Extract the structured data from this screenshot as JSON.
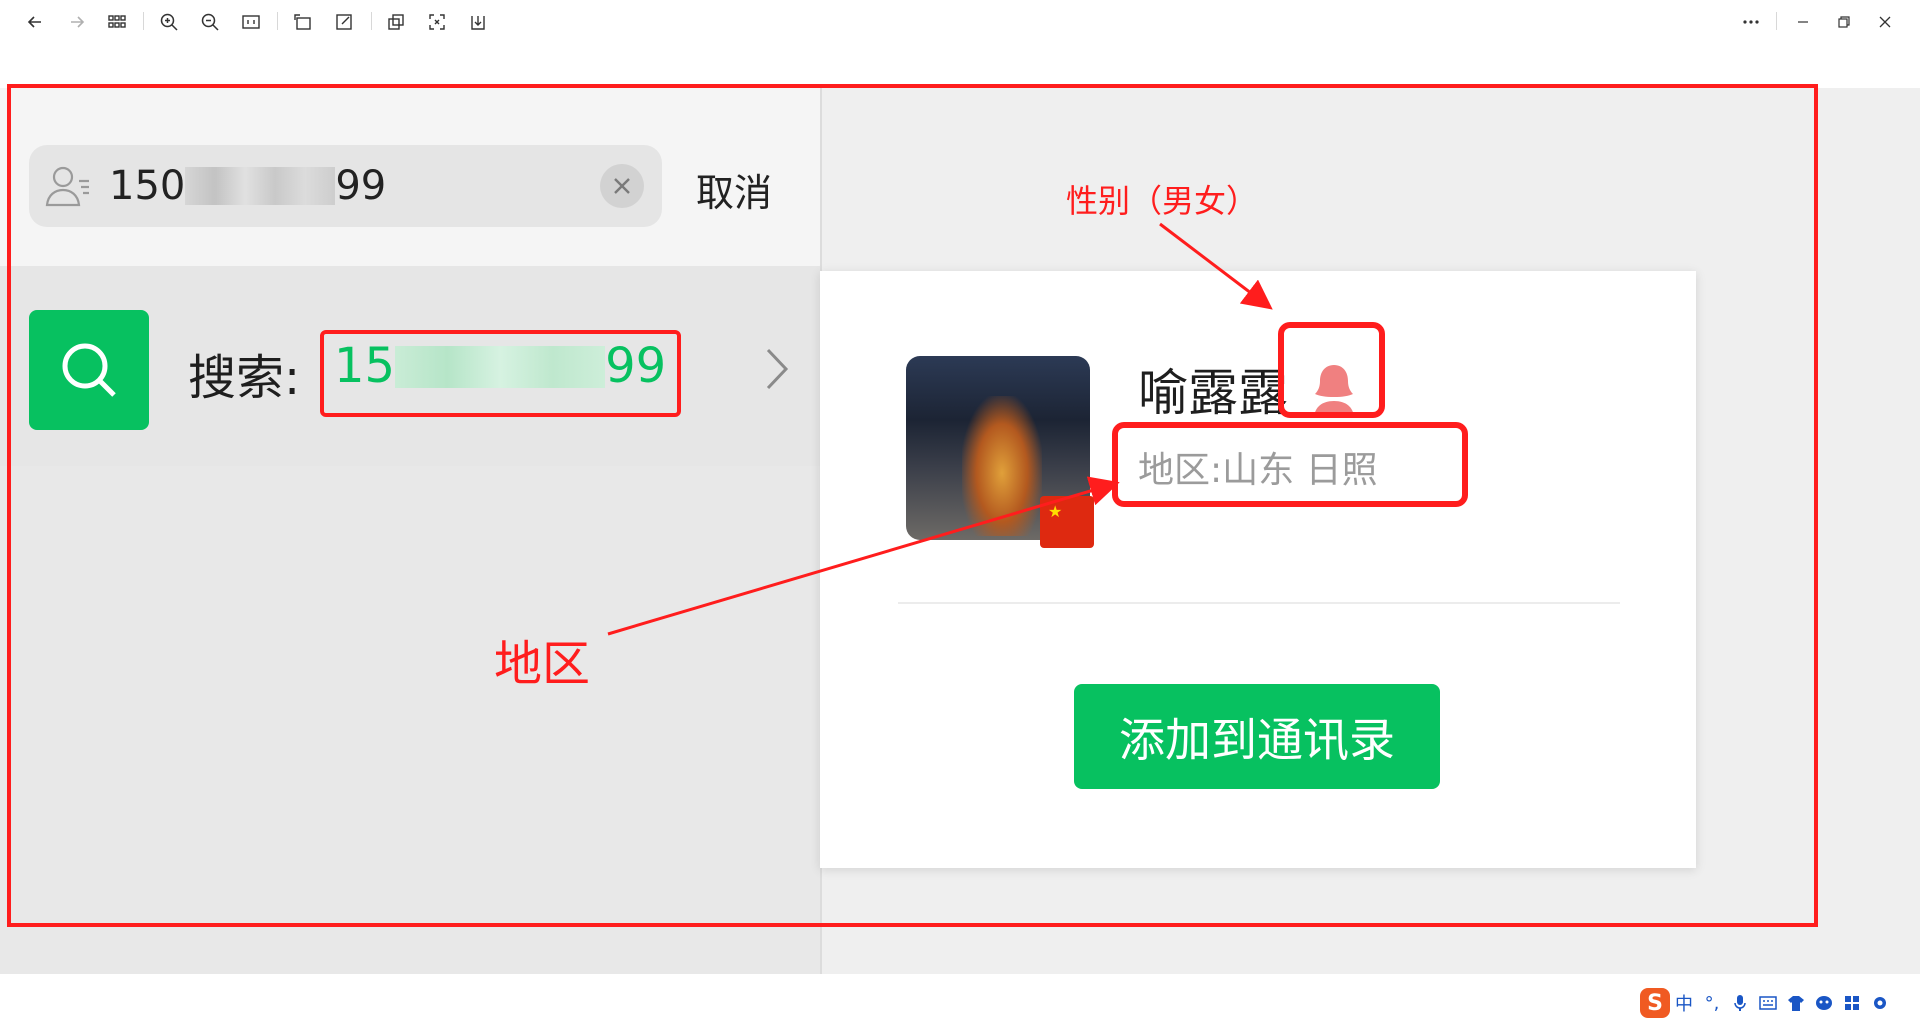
{
  "toolbar": {
    "icons": [
      "back-icon",
      "forward-icon",
      "grid-icon",
      "zoom-in-icon",
      "zoom-out-icon",
      "actual-size-icon",
      "rotate-icon",
      "edit-icon",
      "compare-icon",
      "fit-icon",
      "download-icon",
      "more-icon",
      "minimize-icon",
      "restore-icon",
      "close-icon"
    ]
  },
  "search": {
    "prefix": "150",
    "suffix": "99",
    "cancel_label": "取消"
  },
  "result": {
    "label": "搜索:",
    "num_prefix": "15",
    "num_suffix": "99"
  },
  "profile": {
    "nickname": "喻露露",
    "region": "地区:山东 日照",
    "add_button": "添加到通讯录",
    "gender": "female"
  },
  "annotations": {
    "gender_note": "性别（男女）",
    "region_note": "地区"
  },
  "ime": {
    "chinese_mode": "中",
    "punct": "°,"
  },
  "colors": {
    "accent_green": "#07c160",
    "annotation_red": "#ff1d1d"
  }
}
